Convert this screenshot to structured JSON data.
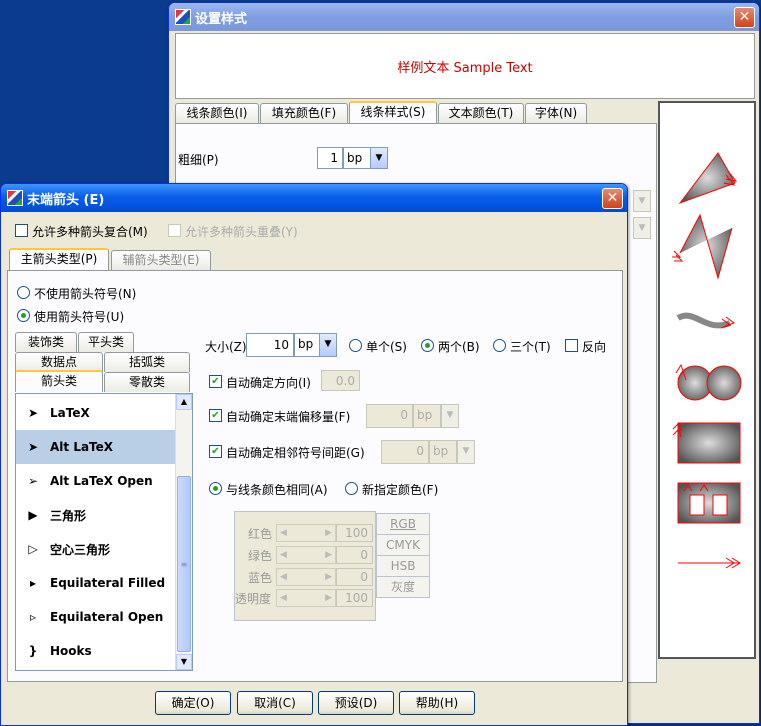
{
  "back_window": {
    "title": "设置样式",
    "close_label": "✕",
    "sample_text": "样例文本 Sample Text",
    "tabs": [
      "线条颜色(I)",
      "填充颜色(F)",
      "线条样式(S)",
      "文本颜色(T)",
      "字体(N)"
    ],
    "active_tab": "线条样式(S)",
    "thickness_label": "粗细(P)",
    "thickness_value": "1",
    "thickness_unit": "bp"
  },
  "front_window": {
    "title": "末端箭头 (E)",
    "close_label": "✕",
    "allow_compound": "允许多种箭头复合(M)",
    "allow_overlap": "允许多种箭头重叠(Y)",
    "tabs": [
      "主箭头类型(P)",
      "辅箭头类型(E)"
    ],
    "no_arrow": "不使用箭头符号(N)",
    "use_arrow": "使用箭头符号(U)",
    "categories": [
      [
        "装饰类",
        "平头类"
      ],
      [
        "数据点",
        "括弧类"
      ],
      [
        "箭头类",
        "零散类"
      ]
    ],
    "arrow_list": [
      {
        "glyph": "➤",
        "name": "LaTeX"
      },
      {
        "glyph": "➤",
        "name": "Alt LaTeX"
      },
      {
        "glyph": "➢",
        "name": "Alt LaTeX Open"
      },
      {
        "glyph": "▶",
        "name": "三角形"
      },
      {
        "glyph": "▷",
        "name": "空心三角形"
      },
      {
        "glyph": "▸",
        "name": "Equilateral Filled"
      },
      {
        "glyph": "▹",
        "name": "Equilateral Open"
      },
      {
        "glyph": "}",
        "name": "Hooks"
      }
    ],
    "selected_item": "Alt LaTeX",
    "size_label": "大小(Z)",
    "size_value": "10",
    "size_unit": "bp",
    "count_single": "单个(S)",
    "count_double": "两个(B)",
    "count_triple": "三个(T)",
    "reverse": "反向",
    "auto_direction": "自动确定方向(I)",
    "auto_direction_value": "0.0",
    "auto_offset": "自动确定末端偏移量(F)",
    "auto_offset_value": "0",
    "auto_offset_unit": "bp",
    "auto_spacing": "自动确定相邻符号间距(G)",
    "auto_spacing_value": "0",
    "auto_spacing_unit": "bp",
    "same_color": "与线条颜色相同(A)",
    "new_color": "新指定颜色(F)",
    "color_rows": [
      {
        "label": "红色",
        "value": "100"
      },
      {
        "label": "绿色",
        "value": "0"
      },
      {
        "label": "蓝色",
        "value": "0"
      },
      {
        "label": "透明度",
        "value": "100"
      }
    ],
    "color_modes": [
      "RGB",
      "CMYK",
      "HSB",
      "灰度"
    ],
    "buttons": [
      "确定(O)",
      "取消(C)",
      "预设(D)",
      "帮助(H)"
    ]
  },
  "colors": {
    "sample_text": "#cc0000",
    "title_gradient": "#0a5fe8",
    "selection": "#b8cfe5",
    "arrow_red": "#ff0000"
  }
}
